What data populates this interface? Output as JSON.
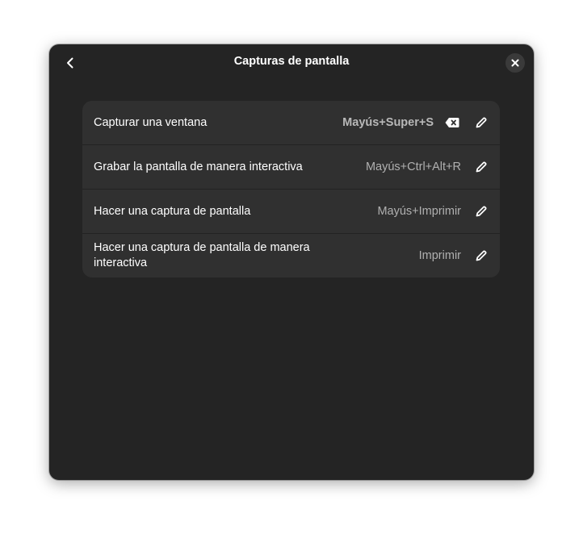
{
  "dialog": {
    "title": "Capturas de pantalla",
    "back_icon": "go-back-icon",
    "close_icon": "close-icon"
  },
  "shortcuts": [
    {
      "label": "Capturar una ventana",
      "accel": "Mayús+Super+S",
      "highlighted": true
    },
    {
      "label": "Grabar la pantalla de manera interactiva",
      "accel": "Mayús+Ctrl+Alt+R"
    },
    {
      "label": "Hacer una captura de pantalla",
      "accel": "Mayús+Imprimir"
    },
    {
      "label": "Hacer una captura de pantalla de manera interactiva",
      "accel": "Imprimir"
    }
  ],
  "colors": {
    "dialog_bg": "#242424",
    "row_bg": "#303030",
    "text": "#ffffff",
    "accel_text": "#b0b0b0"
  }
}
